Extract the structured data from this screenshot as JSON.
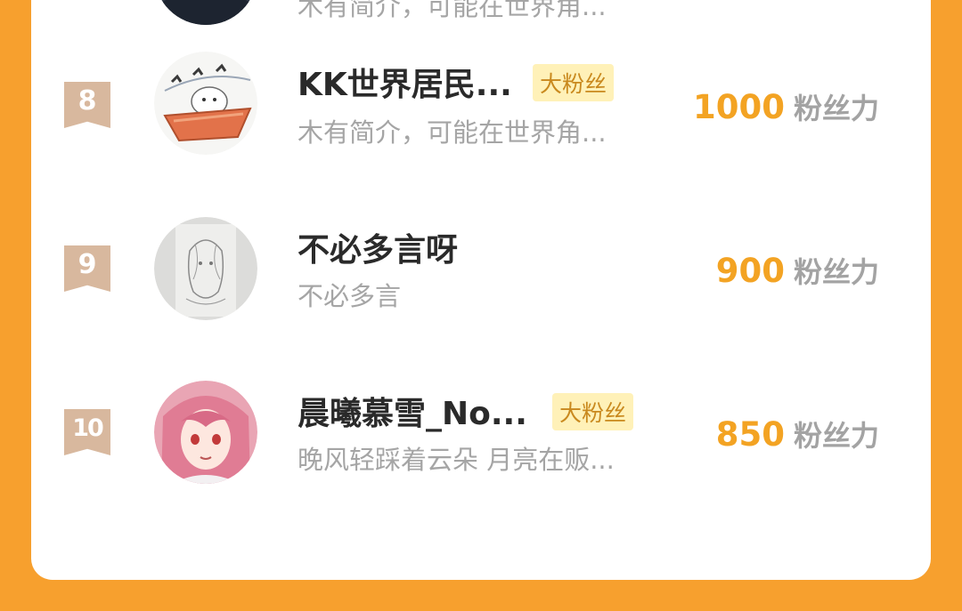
{
  "rows": [
    {
      "rank": "",
      "name": "",
      "badge": "",
      "desc": "木有简介，可能在世界角...",
      "power": "",
      "unit": ""
    },
    {
      "rank": "8",
      "name": "KK世界居民...",
      "badge": "大粉丝",
      "desc": "木有简介，可能在世界角...",
      "power": "1000",
      "unit": "粉丝力"
    },
    {
      "rank": "9",
      "name": "不必多言呀",
      "badge": "",
      "desc": "不必多言",
      "power": "900",
      "unit": "粉丝力"
    },
    {
      "rank": "10",
      "name": "晨曦慕雪_No...",
      "badge": "大粉丝",
      "desc": "晚风轻踩着云朵 月亮在贩...",
      "power": "850",
      "unit": "粉丝力"
    }
  ],
  "colors": {
    "accent": "#f3a323",
    "background": "#f7a02e",
    "rank_bg": "#d8b89e",
    "badge_bg": "#fff1b8"
  },
  "icons": {
    "rank_marker": "ribbon-bookmark-icon"
  }
}
